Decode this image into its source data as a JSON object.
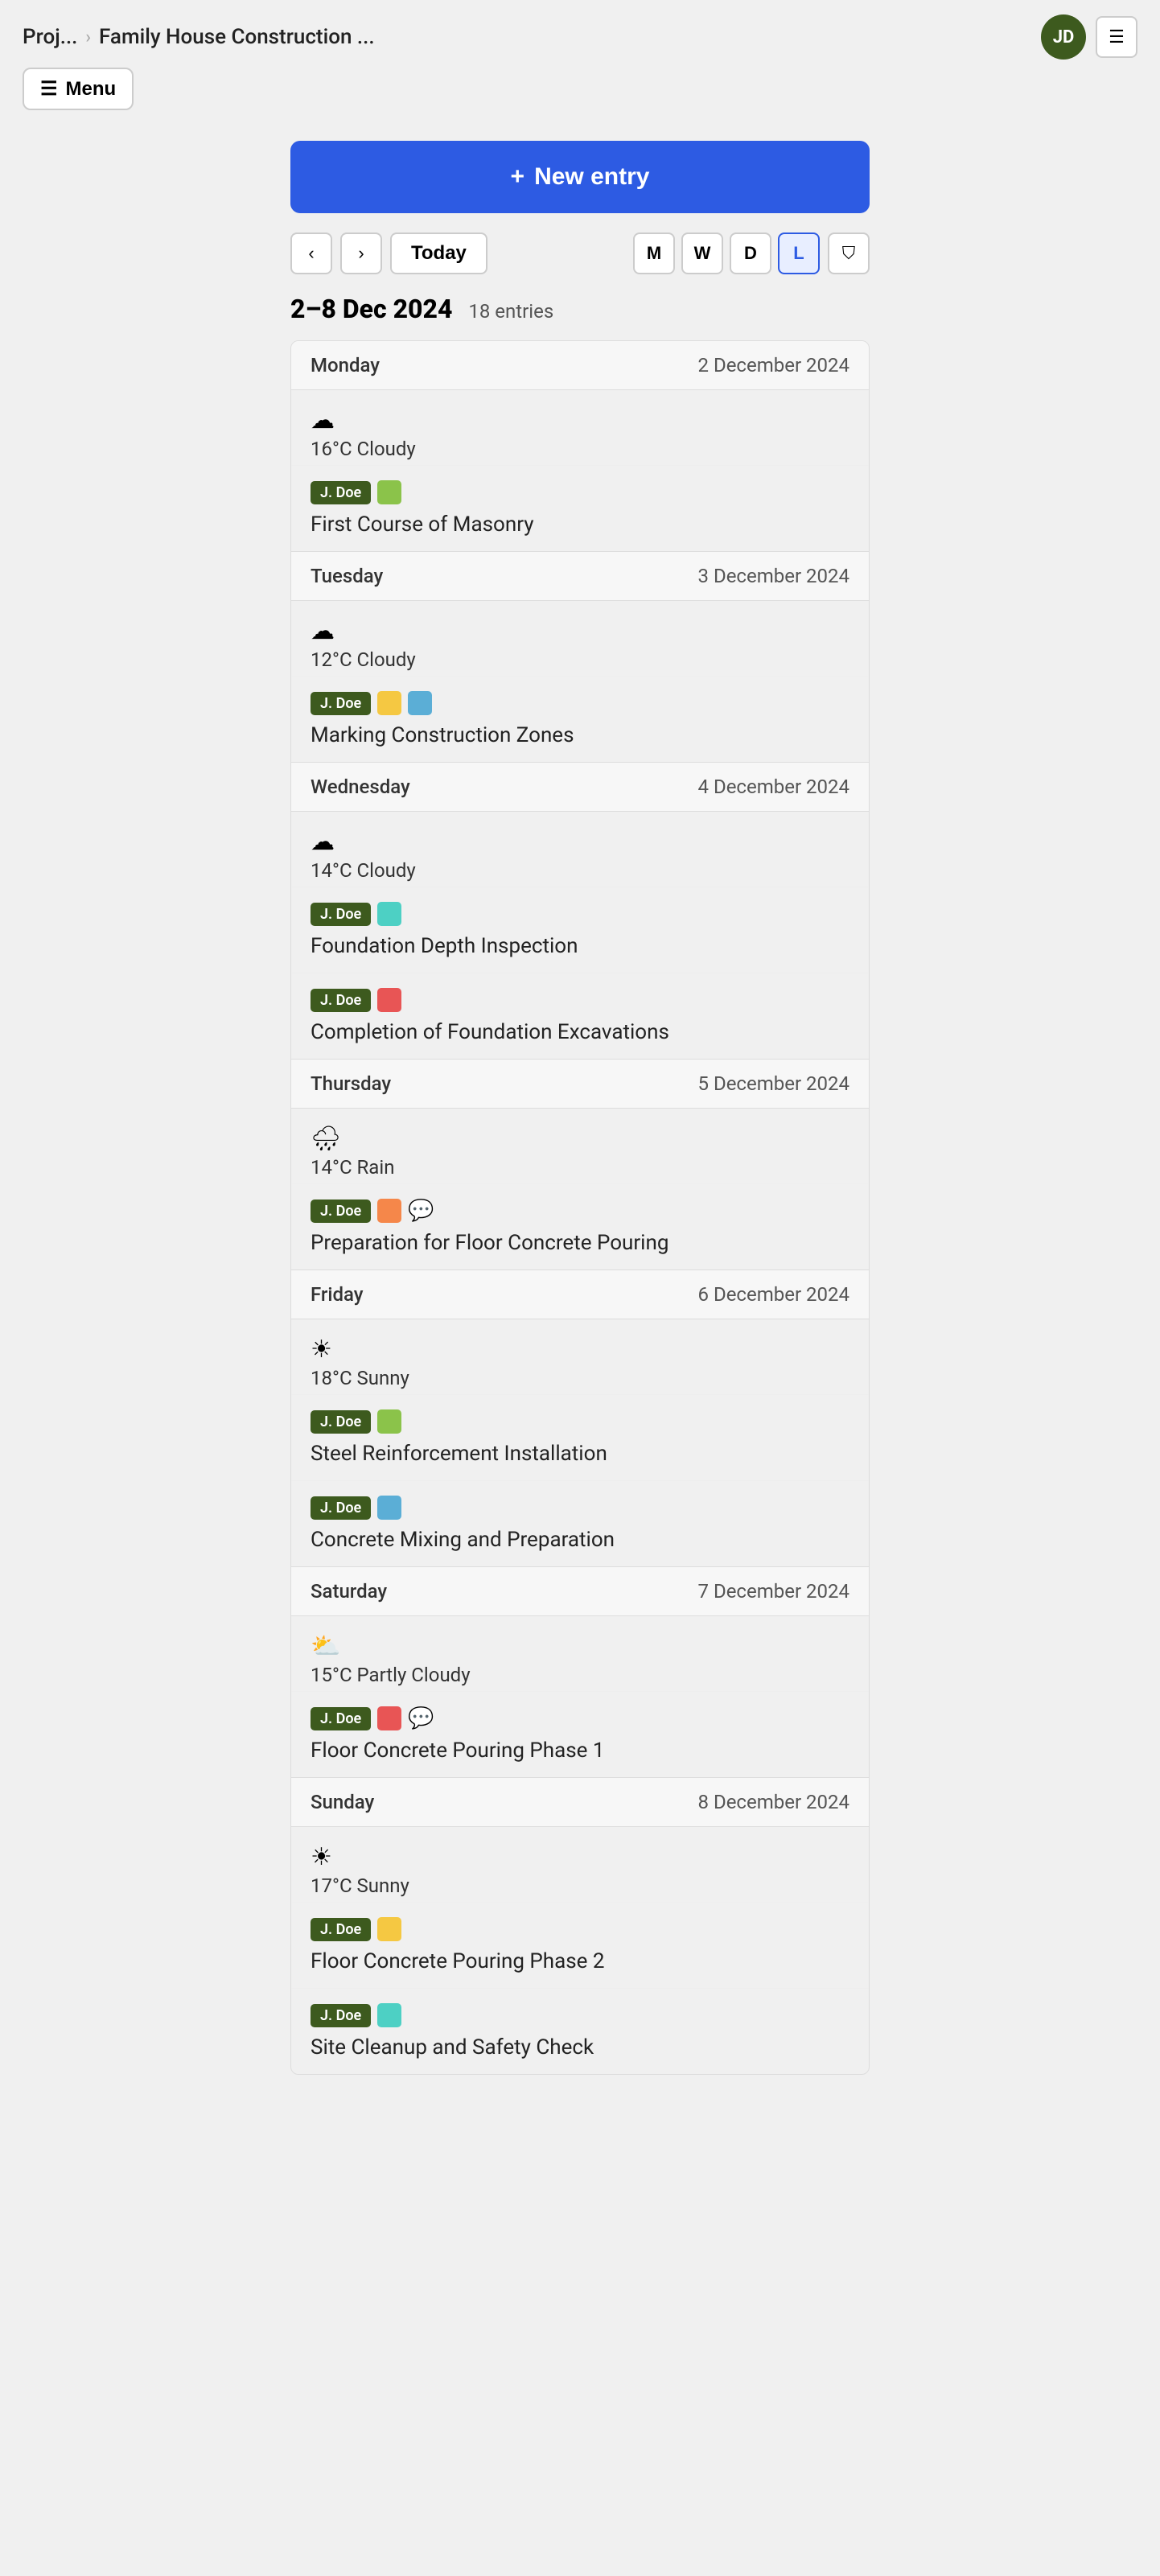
{
  "header": {
    "breadcrumb_short": "Proj...",
    "breadcrumb_full": "Family House Construction ...",
    "avatar_initials": "JD",
    "menu_label": "Menu"
  },
  "toolbar": {
    "new_entry_label": "+ New entry",
    "today_label": "Today",
    "views": [
      {
        "key": "M",
        "label": "M",
        "active": false
      },
      {
        "key": "W",
        "label": "W",
        "active": false
      },
      {
        "key": "D",
        "label": "D",
        "active": false
      },
      {
        "key": "L",
        "label": "L",
        "active": true
      }
    ]
  },
  "week": {
    "range": "2–8 Dec 2024",
    "entries_count": "18 entries"
  },
  "days": [
    {
      "day_name": "Monday",
      "day_date": "2 December 2024",
      "weather_icon": "☁",
      "weather_text": "16°C Cloudy",
      "entries": [
        {
          "user": "J. Doe",
          "colors": [
            "#8bc34a"
          ],
          "title": "First Course of Masonry",
          "has_comment": false
        }
      ]
    },
    {
      "day_name": "Tuesday",
      "day_date": "3 December 2024",
      "weather_icon": "☁",
      "weather_text": "12°C Cloudy",
      "entries": [
        {
          "user": "J. Doe",
          "colors": [
            "#f5c842",
            "#5baed6"
          ],
          "title": "Marking Construction Zones",
          "has_comment": false
        }
      ]
    },
    {
      "day_name": "Wednesday",
      "day_date": "4 December 2024",
      "weather_icon": "☁",
      "weather_text": "14°C Cloudy",
      "entries": [
        {
          "user": "J. Doe",
          "colors": [
            "#4dd0c4"
          ],
          "title": "Foundation Depth Inspection",
          "has_comment": false
        },
        {
          "user": "J. Doe",
          "colors": [
            "#e85555"
          ],
          "title": "Completion of Foundation Excavations",
          "has_comment": false
        }
      ]
    },
    {
      "day_name": "Thursday",
      "day_date": "5 December 2024",
      "weather_icon": "🌧",
      "weather_text": "14°C Rain",
      "entries": [
        {
          "user": "J. Doe",
          "colors": [
            "#f5874a"
          ],
          "title": "Preparation for Floor Concrete Pouring",
          "has_comment": true
        }
      ]
    },
    {
      "day_name": "Friday",
      "day_date": "6 December 2024",
      "weather_icon": "☀",
      "weather_text": "18°C Sunny",
      "entries": [
        {
          "user": "J. Doe",
          "colors": [
            "#8bc34a"
          ],
          "title": "Steel Reinforcement Installation",
          "has_comment": false
        },
        {
          "user": "J. Doe",
          "colors": [
            "#5baed6"
          ],
          "title": "Concrete Mixing and Preparation",
          "has_comment": false
        }
      ]
    },
    {
      "day_name": "Saturday",
      "day_date": "7 December 2024",
      "weather_icon": "⛅",
      "weather_text": "15°C Partly Cloudy",
      "entries": [
        {
          "user": "J. Doe",
          "colors": [
            "#e85555"
          ],
          "title": "Floor Concrete Pouring Phase 1",
          "has_comment": true
        }
      ]
    },
    {
      "day_name": "Sunday",
      "day_date": "8 December 2024",
      "weather_icon": "☀",
      "weather_text": "17°C Sunny",
      "entries": [
        {
          "user": "J. Doe",
          "colors": [
            "#f5c842"
          ],
          "title": "Floor Concrete Pouring Phase 2",
          "has_comment": false
        },
        {
          "user": "J. Doe",
          "colors": [
            "#4dd0c4"
          ],
          "title": "Site Cleanup and Safety Check",
          "has_comment": false
        }
      ]
    }
  ]
}
